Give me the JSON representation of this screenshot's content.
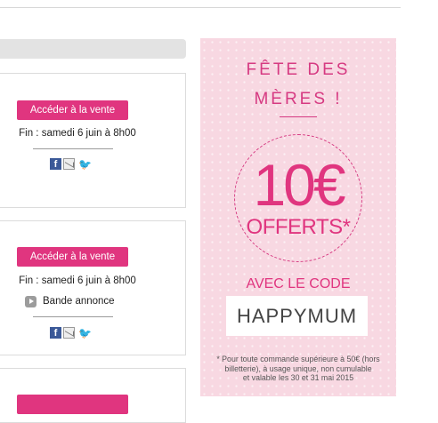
{
  "sales": [
    {
      "button_label": "Accéder à la vente",
      "end_text": "Fin : samedi 6 juin à 8h00"
    },
    {
      "button_label": "Accéder à la vente",
      "end_text": "Fin : samedi 6 juin à 8h00",
      "trailer_label": "Bande annonce"
    }
  ],
  "promo": {
    "title_line1": "FÊTE DES",
    "title_line2": "MÈRES !",
    "amount": "10€",
    "offered": "OFFERTS*",
    "with_code": "AVEC LE CODE",
    "code": "HAPPYMUM",
    "fine_print_line1": "* Pour toute commande supérieure à 50€ (hors",
    "fine_print_line2": "billetterie), à usage unique, non cumulable",
    "fine_print_line3": "et valable les 30 et 31 mai 2015"
  },
  "icons": {
    "facebook": "facebook-icon",
    "email": "email-icon",
    "twitter": "twitter-icon",
    "play": "play-icon"
  },
  "colors": {
    "accent": "#e0357f",
    "promo_bg": "#f8d8e2"
  }
}
